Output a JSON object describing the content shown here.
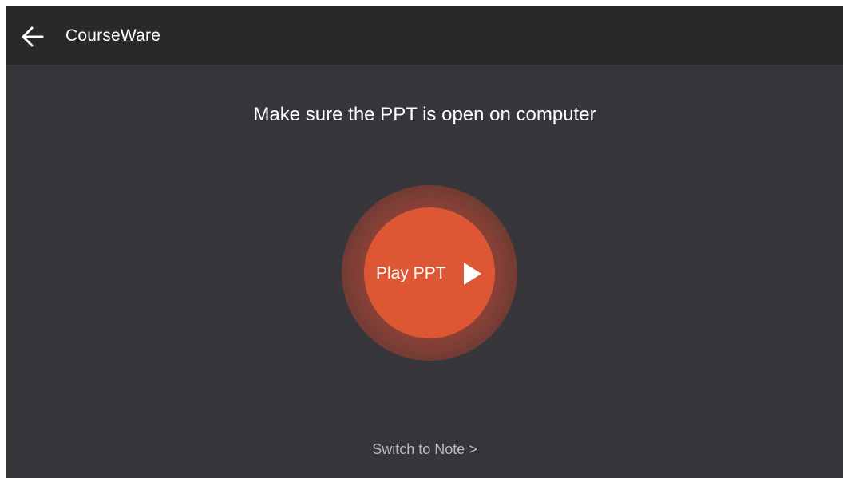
{
  "header": {
    "back_icon": "arrow-left-icon",
    "title": "CourseWare"
  },
  "main": {
    "instruction": "Make sure the PPT is open on computer",
    "play_button": {
      "label": "Play PPT",
      "icon": "play-triangle-icon"
    },
    "switch_link": "Switch to Note >"
  },
  "colors": {
    "background": "#37373b",
    "header_background": "#29292c",
    "accent": "#dd5734",
    "halo": "#8e4237",
    "primary_text": "#ffffff",
    "secondary_text": "#b9b9bc"
  }
}
